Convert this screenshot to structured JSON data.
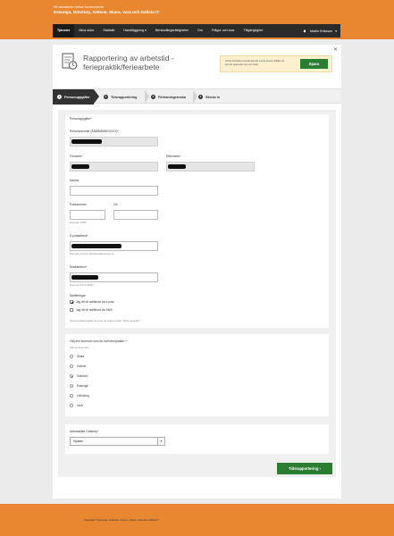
{
  "header": {
    "subtitle": "Ett samarbete mellan kommunerna",
    "title": "Essunga, Grästorp, Götene, Skara, Vara och Gällsta IT"
  },
  "nav": {
    "items": [
      "Tjänster",
      "Mina sidor",
      "Statistik",
      "Handläggning",
      "Behandlingsrättigheter",
      "Om",
      "Frågor och svar",
      "Tillgänglighet"
    ],
    "user": "Martin Eriksson"
  },
  "form_header": {
    "title_line1": "Rapportering av arbetstid -",
    "title_line2": "feriepraktik/feriearbete",
    "save_hint": "Vill du fortsätta med ditt ärende vid ett senare tillfälle så kan du spara det när som helst.",
    "save_label": "Spara"
  },
  "steps": [
    {
      "num": "1",
      "label": "Personuppgifter"
    },
    {
      "num": "2",
      "label": "Tidsrapportering"
    },
    {
      "num": "3",
      "label": "Förhandsgranska"
    },
    {
      "num": "4",
      "label": "Skicka in"
    }
  ],
  "personal": {
    "section_label": "Personuppgifter*",
    "pnr_label": "Personnummer (ÅÅÅÅMMDDXXXX)*",
    "first_label": "Förnamn*",
    "last_label": "Efternamn*",
    "address_label": "Adress",
    "zip_label": "Postnummer",
    "city_label": "Ort",
    "zip_hint": "Exempel: 12345",
    "email_label": "E-postadress*",
    "email_hint": "Exempel: fornamn.efternamn@exempel.se",
    "phone_label": "Mobiltelefon*",
    "phone_hint": "Exempel: 070-1234567",
    "notif_label": "Notifieringar",
    "notif_email": "Jag vill bli notifierad via e-post",
    "notif_sms": "Jag vill bli notifierad via SMS",
    "contact_note": "Dina kontaktuppgifter kommer att sparas under \"Mina uppgifter\""
  },
  "municipality": {
    "question": "Välj den kommun som du haft feriepraktik i *",
    "instruction": "Välj ett alternativ",
    "options": [
      "Skara",
      "Götene",
      "Grästorp",
      "Essunga",
      "Lidköping",
      "Vara"
    ],
    "selected": "Grästorp"
  },
  "workplace": {
    "label": "Arbetsställe Grästorp*",
    "value": "Hylaten"
  },
  "next_label": "Tidsrapportering",
  "footer": {
    "copyright": "Copyright © Essunga, Grästorp, Götene, Skara, Vara och Gällsta IT"
  }
}
